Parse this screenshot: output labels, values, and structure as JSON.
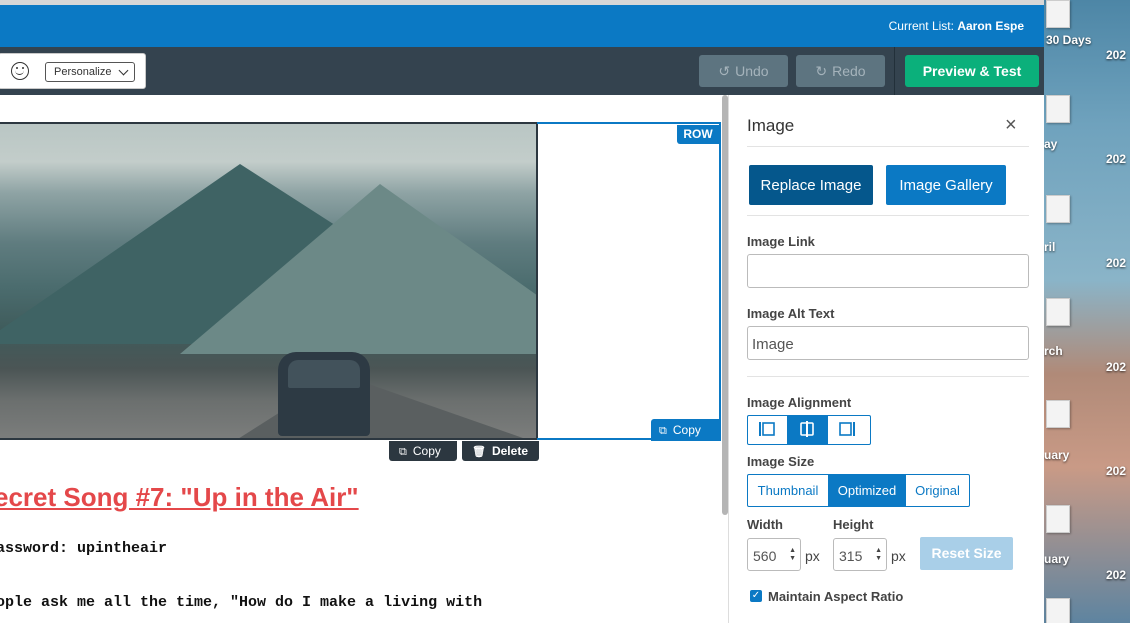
{
  "header": {
    "current_list_label": "Current List:",
    "current_list_name": "Aaron Espe"
  },
  "toolbar": {
    "personalize": "Personalize",
    "undo": "Undo",
    "redo": "Redo",
    "preview": "Preview & Test"
  },
  "canvas": {
    "row_badge": "ROW",
    "row_copy": "Copy",
    "block_copy": "Copy",
    "block_delete": "Delete",
    "heading": "ecret Song #7: \"Up in the Air\"",
    "password_line": "assword: upintheair",
    "body_line": "ople ask me all the time, \"How do I make a living with"
  },
  "panel": {
    "title": "Image",
    "replace_image": "Replace Image",
    "image_gallery": "Image Gallery",
    "image_link_label": "Image Link",
    "image_link_value": "",
    "alt_text_label": "Image Alt Text",
    "alt_text_value": "Image",
    "alignment_label": "Image Alignment",
    "alignment_selected": "center",
    "size_label": "Image Size",
    "sizes": [
      "Thumbnail",
      "Optimized",
      "Original"
    ],
    "size_selected": "Optimized",
    "width_label": "Width",
    "height_label": "Height",
    "width_value": "560",
    "height_value": "315",
    "unit": "px",
    "reset_size": "Reset Size",
    "maintain_aspect": "Maintain Aspect Ratio",
    "maintain_checked": true
  },
  "desktop": {
    "labels": [
      "30 Days",
      "202",
      "ay",
      "202",
      "ril",
      "202",
      "rch",
      "202",
      "uary",
      "202",
      "uary",
      "202"
    ]
  },
  "colors": {
    "brand_blue": "#0b79c4",
    "toolbar": "#34434f",
    "preview_green": "#0bb07b",
    "heading_red": "#e4484a"
  }
}
